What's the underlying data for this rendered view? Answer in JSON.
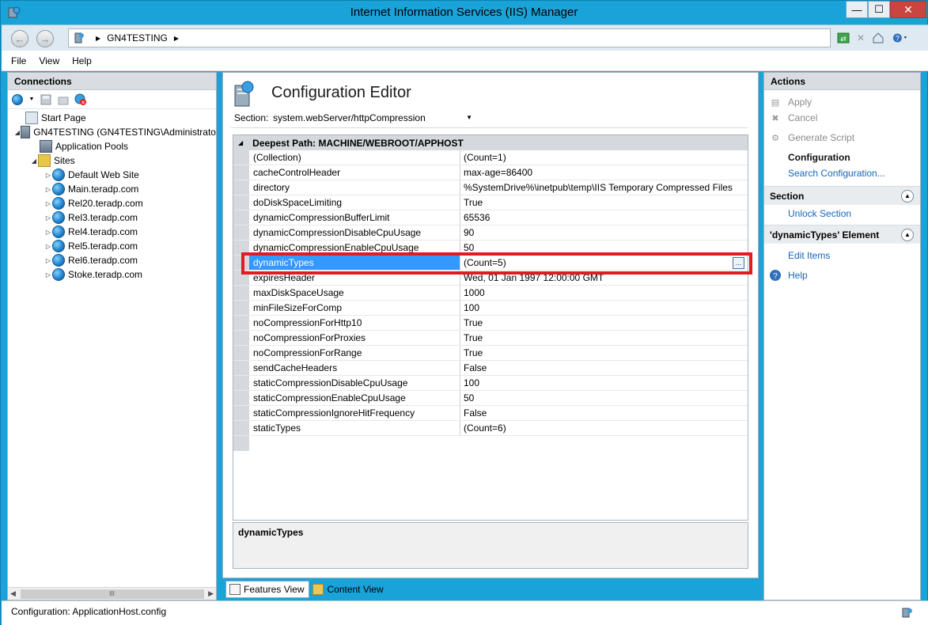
{
  "window": {
    "title": "Internet Information Services (IIS) Manager",
    "min_label": "—",
    "max_label": "☐",
    "close_label": "✕"
  },
  "address": {
    "crumb": "GN4TESTING",
    "sep1": "▶",
    "sep2": "▶"
  },
  "menu": {
    "file": "File",
    "view": "View",
    "help": "Help"
  },
  "connections": {
    "header": "Connections",
    "tree": {
      "start_page": "Start Page",
      "server": "GN4TESTING (GN4TESTING\\Administrato",
      "app_pools": "Application Pools",
      "sites": "Sites",
      "site_list": [
        "Default Web Site",
        "Main.teradp.com",
        "Rel20.teradp.com",
        "Rel3.teradp.com",
        "Rel4.teradp.com",
        "Rel5.teradp.com",
        "Rel6.teradp.com",
        "Stoke.teradp.com"
      ]
    },
    "scroll_grip": "III"
  },
  "editor": {
    "title": "Configuration Editor",
    "section_label": "Section:",
    "section_value": "system.webServer/httpCompression",
    "grid_header": "Deepest Path: MACHINE/WEBROOT/APPHOST",
    "rows": [
      {
        "k": "(Collection)",
        "v": "(Count=1)"
      },
      {
        "k": "cacheControlHeader",
        "v": "max-age=86400"
      },
      {
        "k": "directory",
        "v": "%SystemDrive%\\inetpub\\temp\\IIS Temporary Compressed Files"
      },
      {
        "k": "doDiskSpaceLimiting",
        "v": "True"
      },
      {
        "k": "dynamicCompressionBufferLimit",
        "v": "65536"
      },
      {
        "k": "dynamicCompressionDisableCpuUsage",
        "v": "90"
      },
      {
        "k": "dynamicCompressionEnableCpuUsage",
        "v": "50"
      },
      {
        "k": "dynamicTypes",
        "v": "(Count=5)",
        "selected": true
      },
      {
        "k": "expiresHeader",
        "v": "Wed, 01 Jan 1997 12:00:00 GMT"
      },
      {
        "k": "maxDiskSpaceUsage",
        "v": "1000"
      },
      {
        "k": "minFileSizeForComp",
        "v": "100"
      },
      {
        "k": "noCompressionForHttp10",
        "v": "True"
      },
      {
        "k": "noCompressionForProxies",
        "v": "True"
      },
      {
        "k": "noCompressionForRange",
        "v": "True"
      },
      {
        "k": "sendCacheHeaders",
        "v": "False"
      },
      {
        "k": "staticCompressionDisableCpuUsage",
        "v": "100"
      },
      {
        "k": "staticCompressionEnableCpuUsage",
        "v": "50"
      },
      {
        "k": "staticCompressionIgnoreHitFrequency",
        "v": "False"
      },
      {
        "k": "staticTypes",
        "v": "(Count=6)"
      }
    ],
    "ellipsis": "...",
    "description": "dynamicTypes",
    "tab_features": "Features View",
    "tab_content": "Content View"
  },
  "actions": {
    "header": "Actions",
    "apply": "Apply",
    "cancel": "Cancel",
    "generate_script": "Generate Script",
    "configuration": "Configuration",
    "search_configuration": "Search Configuration...",
    "section_group": "Section",
    "unlock_section": "Unlock Section",
    "element_group": "'dynamicTypes' Element",
    "edit_items": "Edit Items",
    "help": "Help"
  },
  "status": {
    "text": "Configuration: ApplicationHost.config"
  },
  "colors": {
    "selection": "#3399ff",
    "highlight": "#e11b22",
    "link": "#1466b8"
  }
}
